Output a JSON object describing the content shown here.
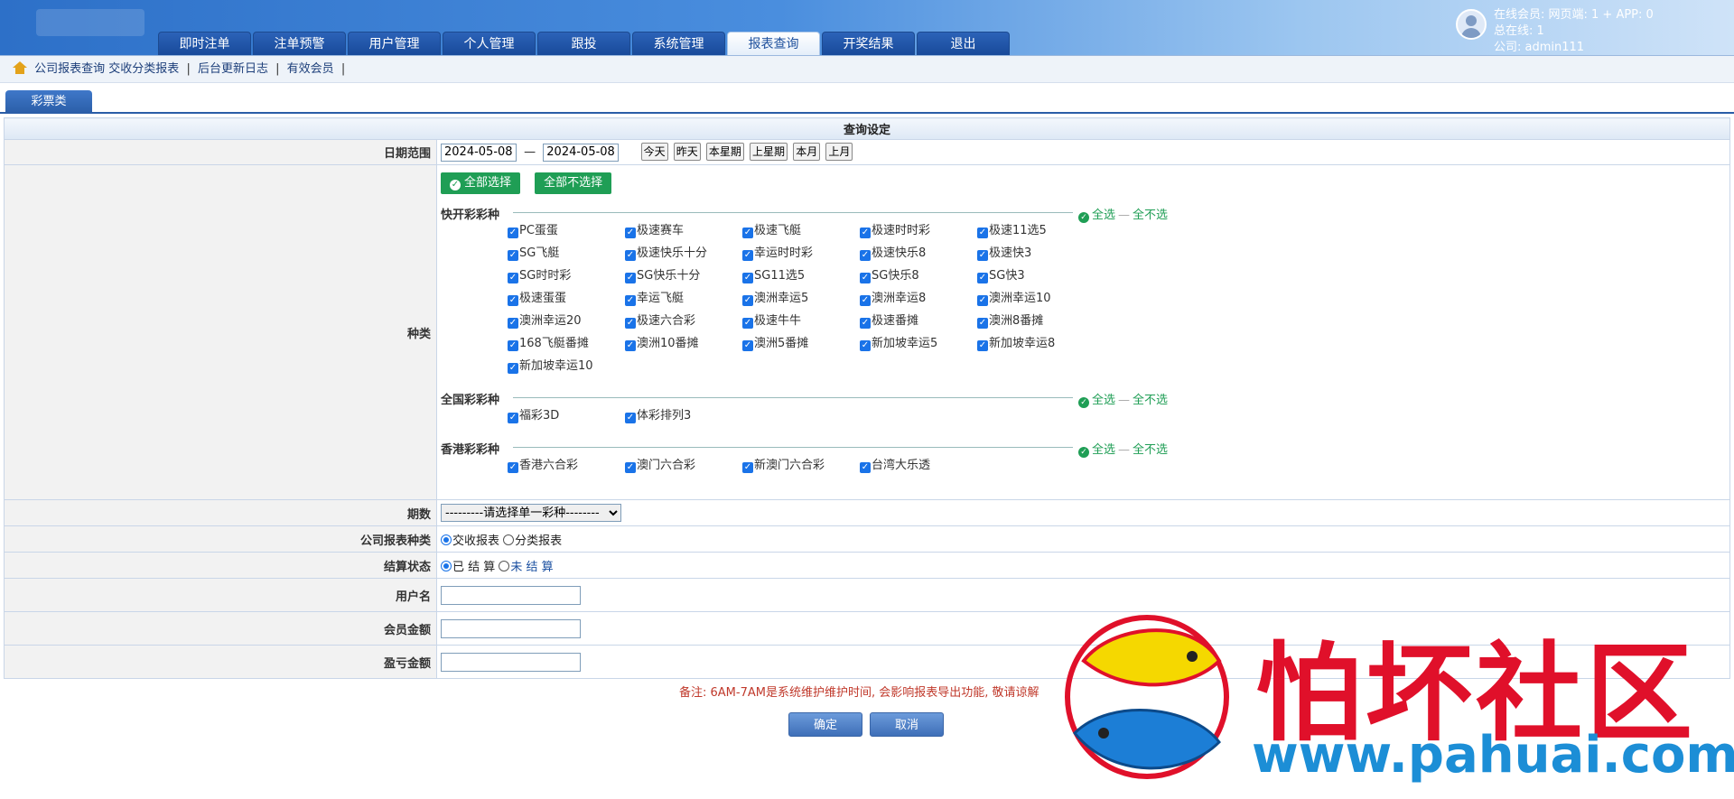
{
  "nav": {
    "tabs": [
      {
        "label": "即时注单"
      },
      {
        "label": "注单预警"
      },
      {
        "label": "用户管理"
      },
      {
        "label": "个人管理"
      },
      {
        "label": "跟投"
      },
      {
        "label": "系统管理"
      },
      {
        "label": "报表查询"
      },
      {
        "label": "开奖结果"
      },
      {
        "label": "退出"
      }
    ],
    "active_index": 6
  },
  "user_info": {
    "online_line": "在线会员:  网页端: 1 + APP: 0",
    "total_line": "总在线:  1",
    "company_line": "公司: admin111"
  },
  "breadcrumb": {
    "items": [
      "公司报表查询",
      "交收分类报表",
      "后台更新日志",
      "有效会员"
    ],
    "sep": "|"
  },
  "subtab": {
    "label": "彩票类"
  },
  "form": {
    "title": "查询设定",
    "date_range": {
      "label": "日期范围",
      "start": "2024-05-08",
      "end": "2024-05-08",
      "dash": "—",
      "quick": [
        "今天",
        "昨天",
        "本星期",
        "上星期",
        "本月",
        "上月"
      ]
    },
    "kind": {
      "label": "种类",
      "select_all": "全部选择",
      "unselect_all": "全部不选择",
      "group_all": "全选",
      "group_none": "全不选",
      "groups": [
        {
          "title": "快开彩彩种",
          "items": [
            "PC蛋蛋",
            "极速赛车",
            "极速飞艇",
            "极速时时彩",
            "极速11选5",
            "SG飞艇",
            "极速快乐十分",
            "幸运时时彩",
            "极速快乐8",
            "极速快3",
            "SG时时彩",
            "SG快乐十分",
            "SG11选5",
            "SG快乐8",
            "SG快3",
            "极速蛋蛋",
            "幸运飞艇",
            "澳洲幸运5",
            "澳洲幸运8",
            "澳洲幸运10",
            "澳洲幸运20",
            "极速六合彩",
            "极速牛牛",
            "极速番摊",
            "澳洲8番摊",
            "168飞艇番摊",
            "澳洲10番摊",
            "澳洲5番摊",
            "新加坡幸运5",
            "新加坡幸运8",
            "新加坡幸运10"
          ]
        },
        {
          "title": "全国彩彩种",
          "items": [
            "福彩3D",
            "体彩排列3"
          ]
        },
        {
          "title": "香港彩彩种",
          "items": [
            "香港六合彩",
            "澳门六合彩",
            "新澳门六合彩",
            "台湾大乐透"
          ]
        }
      ]
    },
    "issue": {
      "label": "期数",
      "selected": "---------请选择单一彩种--------"
    },
    "report_type": {
      "label": "公司报表种类",
      "options": [
        "交收报表",
        "分类报表"
      ],
      "selected": 0
    },
    "settle_status": {
      "label": "结算状态",
      "options": [
        "已 结 算",
        "未 结 算"
      ],
      "selected": 0
    },
    "username": {
      "label": "用户名",
      "value": ""
    },
    "member_amount": {
      "label": "会员金额",
      "value": ""
    },
    "profit_amount": {
      "label": "盈亏金额",
      "value": ""
    },
    "note": "备注: 6AM-7AM是系统维护维护时间, 会影响报表导出功能, 敬请谅解",
    "confirm": "确定",
    "cancel": "取消"
  },
  "watermark": {
    "cn": "怕坏社区",
    "url": "www.pahuai.com"
  },
  "colors": {
    "header_blue": "#2d70c8",
    "green": "#1f9e55",
    "note_red": "#c0392b",
    "watermark_red": "#e0102a",
    "watermark_blue": "#1c8ed6"
  }
}
